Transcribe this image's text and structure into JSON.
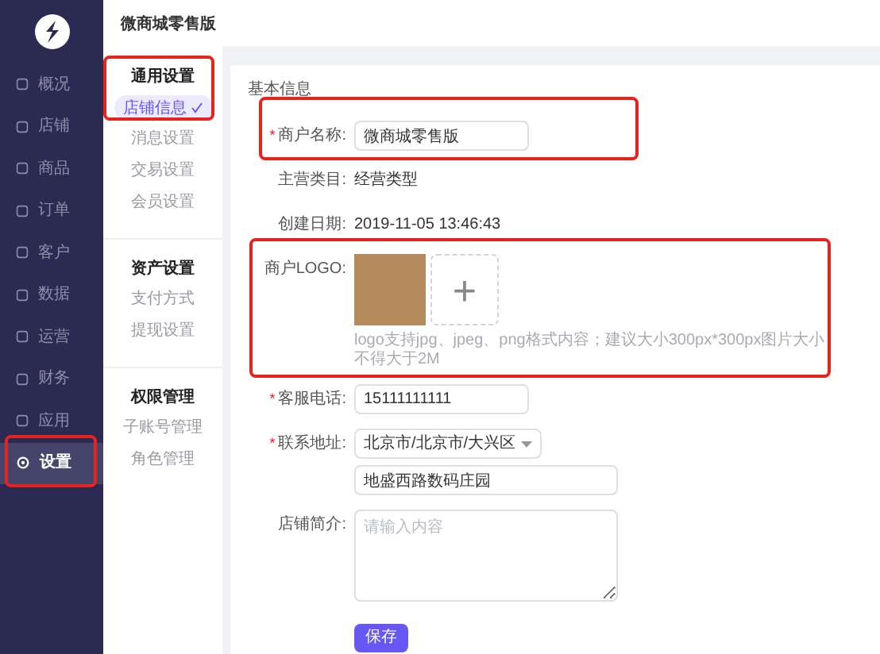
{
  "app": {
    "title": "微商城零售版"
  },
  "sidebar": {
    "items": [
      {
        "label": "概况",
        "selected": false
      },
      {
        "label": "店铺",
        "selected": false
      },
      {
        "label": "商品",
        "selected": false
      },
      {
        "label": "订单",
        "selected": false
      },
      {
        "label": "客户",
        "selected": false
      },
      {
        "label": "数据",
        "selected": false
      },
      {
        "label": "运营",
        "selected": false
      },
      {
        "label": "财务",
        "selected": false
      },
      {
        "label": "应用",
        "selected": false
      },
      {
        "label": "设置",
        "selected": true
      }
    ]
  },
  "subnav": [
    {
      "title": "通用设置",
      "items": [
        {
          "label": "店铺信息",
          "selected": true
        },
        {
          "label": "消息设置",
          "selected": false
        },
        {
          "label": "交易设置",
          "selected": false
        },
        {
          "label": "会员设置",
          "selected": false
        }
      ]
    },
    {
      "title": "资产设置",
      "items": [
        {
          "label": "支付方式",
          "selected": false
        },
        {
          "label": "提现设置",
          "selected": false
        }
      ]
    },
    {
      "title": "权限管理",
      "items": [
        {
          "label": "子账号管理",
          "selected": false
        },
        {
          "label": "角色管理",
          "selected": false
        }
      ]
    }
  ],
  "form": {
    "section": "基本信息",
    "rows": [
      {
        "kind": "input",
        "label": "商户名称:",
        "required_mark": "*",
        "value": "微商城零售版"
      },
      {
        "kind": "text",
        "label": "主营类目:",
        "value": "经营类型"
      },
      {
        "kind": "text",
        "label": "创建日期:",
        "value": "2019-11-05 13:46:43"
      },
      {
        "kind": "upload",
        "label": "商户LOGO:",
        "upload_symbol": "+",
        "hint": "logo支持jpg、jpeg、png格式内容；建议大小300px*300px图片大小不得大于2M"
      },
      {
        "kind": "input",
        "label": "客服电话:",
        "required_mark": "*",
        "value": "15111111111"
      },
      {
        "kind": "address",
        "label": "联系地址:",
        "required_mark": "*",
        "value": "北京市/北京市/大兴区",
        "detail": "地盛西路数码庄园"
      },
      {
        "kind": "textarea",
        "label": "店铺简介:",
        "placeholder": "请输入内容"
      }
    ],
    "submit": "保存"
  }
}
